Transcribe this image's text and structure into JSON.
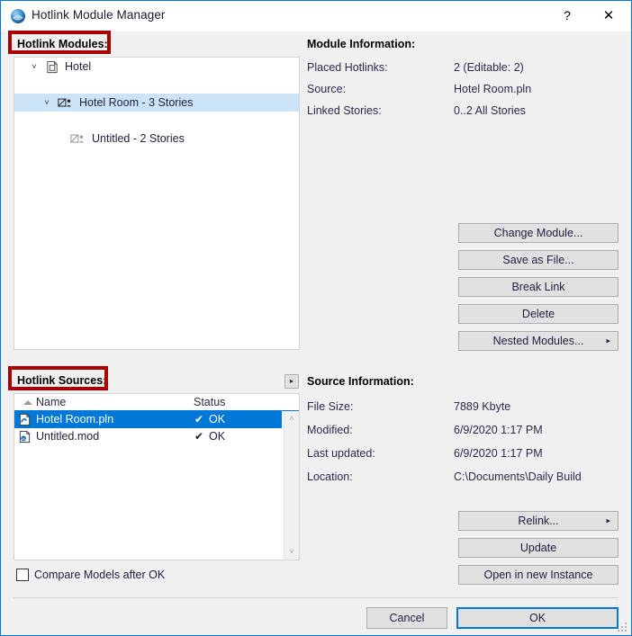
{
  "window": {
    "title": "Hotlink Module Manager",
    "app_icon": "archicad-sphere-icon",
    "help_button": "?",
    "close_button": "✕"
  },
  "modules_section": {
    "label": "Hotlink Modules:",
    "tree": [
      {
        "label": "Hotel",
        "indent": 0,
        "chevron": "˅",
        "icon": "document-icon",
        "selected": false
      },
      {
        "label": "Hotel Room - 3 Stories",
        "indent": 1,
        "chevron": "˅",
        "icon": "module-icon",
        "selected": true
      },
      {
        "label": "Untitled - 2 Stories",
        "indent": 2,
        "chevron": "",
        "icon": "nested-module-icon",
        "selected": false
      }
    ]
  },
  "module_information": {
    "heading": "Module Information:",
    "rows": [
      {
        "key": "Placed Hotlinks:",
        "value": "2 (Editable: 2)"
      },
      {
        "key": "Source:",
        "value": "Hotel Room.pln"
      },
      {
        "key": "Linked Stories:",
        "value": "0..2 All Stories"
      }
    ]
  },
  "module_buttons": [
    {
      "label": "Change Module...",
      "arrow": ""
    },
    {
      "label": "Save as File...",
      "arrow": ""
    },
    {
      "label": "Break Link",
      "arrow": ""
    },
    {
      "label": "Delete",
      "arrow": ""
    },
    {
      "label": "Nested Modules...",
      "arrow": "▸"
    }
  ],
  "sources_section": {
    "label": "Hotlink Sources:",
    "expander": "▸",
    "columns": [
      "Name",
      "Status"
    ],
    "sort_indicator": "ascending",
    "rows": [
      {
        "name": "Hotel Room.pln",
        "check": "✔",
        "status": "OK",
        "icon": "pln-file-icon",
        "selected": true
      },
      {
        "name": "Untitled.mod",
        "check": "✔",
        "status": "OK",
        "icon": "mod-file-icon",
        "selected": false
      }
    ],
    "scroll_up": "˄",
    "scroll_down": "˅"
  },
  "source_information": {
    "heading": "Source Information:",
    "rows": [
      {
        "key": "File Size:",
        "value": "7889 Kbyte"
      },
      {
        "key": "Modified:",
        "value": "6/9/2020 1:17 PM"
      },
      {
        "key": "Last updated:",
        "value": "6/9/2020 1:17 PM"
      },
      {
        "key": "Location:",
        "value": "C:\\Documents\\Daily Build"
      }
    ]
  },
  "source_buttons": [
    {
      "label": "Relink...",
      "arrow": "▸"
    },
    {
      "label": "Update",
      "arrow": ""
    },
    {
      "label": "Open in new Instance",
      "arrow": ""
    }
  ],
  "footer": {
    "compare_checkbox_label": "Compare Models after OK",
    "compare_checked": false,
    "cancel_label": "Cancel",
    "ok_label": "OK"
  },
  "colors": {
    "accent": "#0078d7",
    "highlight_box": "#a80000",
    "tree_selection": "#cce4f7",
    "list_selection": "#0078d7",
    "button_face": "#e1e1e1"
  }
}
